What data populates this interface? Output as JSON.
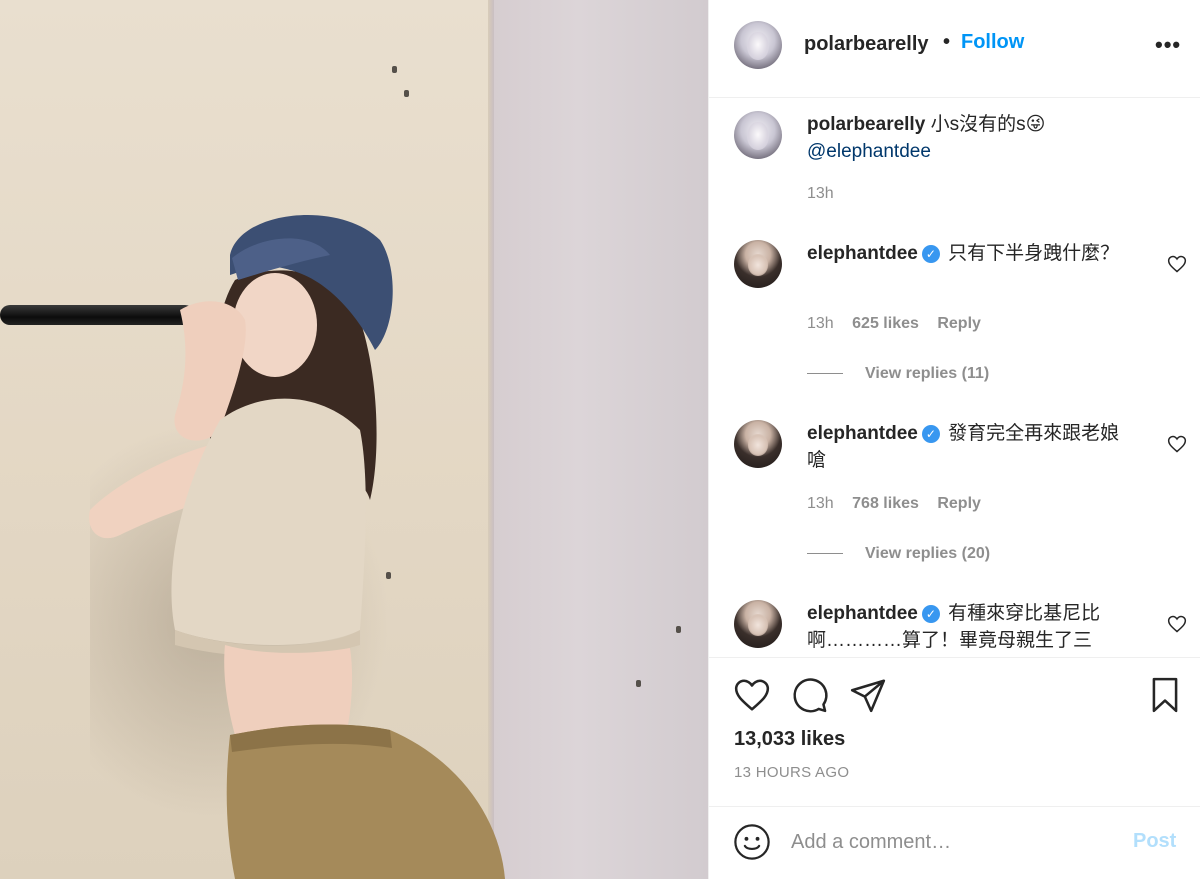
{
  "header": {
    "username": "polarbearelly",
    "separator": "•",
    "follow_label": "Follow",
    "more_label": "•••"
  },
  "caption": {
    "username": "polarbearelly",
    "text": "小s沒有的s😜",
    "mention": "@elephantdee",
    "time": "13h"
  },
  "comments": [
    {
      "username": "elephantdee",
      "verified_mark": "✓",
      "text": "只有下半身跩什麼？",
      "time": "13h",
      "likes": "625 likes",
      "reply_label": "Reply",
      "view_replies": "View replies (11)"
    },
    {
      "username": "elephantdee",
      "verified_mark": "✓",
      "text": "發育完全再來跟老娘嗆",
      "time": "13h",
      "likes": "768 likes",
      "reply_label": "Reply",
      "view_replies": "View replies (20)"
    },
    {
      "username": "elephantdee",
      "verified_mark": "✓",
      "text": "有種來穿比基尼比啊…………算了！畢竟母親生了三",
      "time": "",
      "likes": "",
      "reply_label": "",
      "view_replies": ""
    }
  ],
  "post": {
    "likes": "13,033 likes",
    "time_ago": "13 HOURS AGO"
  },
  "composer": {
    "placeholder": "Add a comment…",
    "post_label": "Post"
  },
  "icons": {
    "like": "heart-icon",
    "comment": "comment-icon",
    "share": "paper-plane-icon",
    "save": "bookmark-icon",
    "emoji": "smiley-icon",
    "more": "more-options-icon"
  },
  "colors": {
    "link_blue": "#0095f6",
    "mention": "#00376b",
    "muted": "#8e8e8e",
    "post_disabled": "#b2dffc",
    "verified": "#3897f0"
  }
}
